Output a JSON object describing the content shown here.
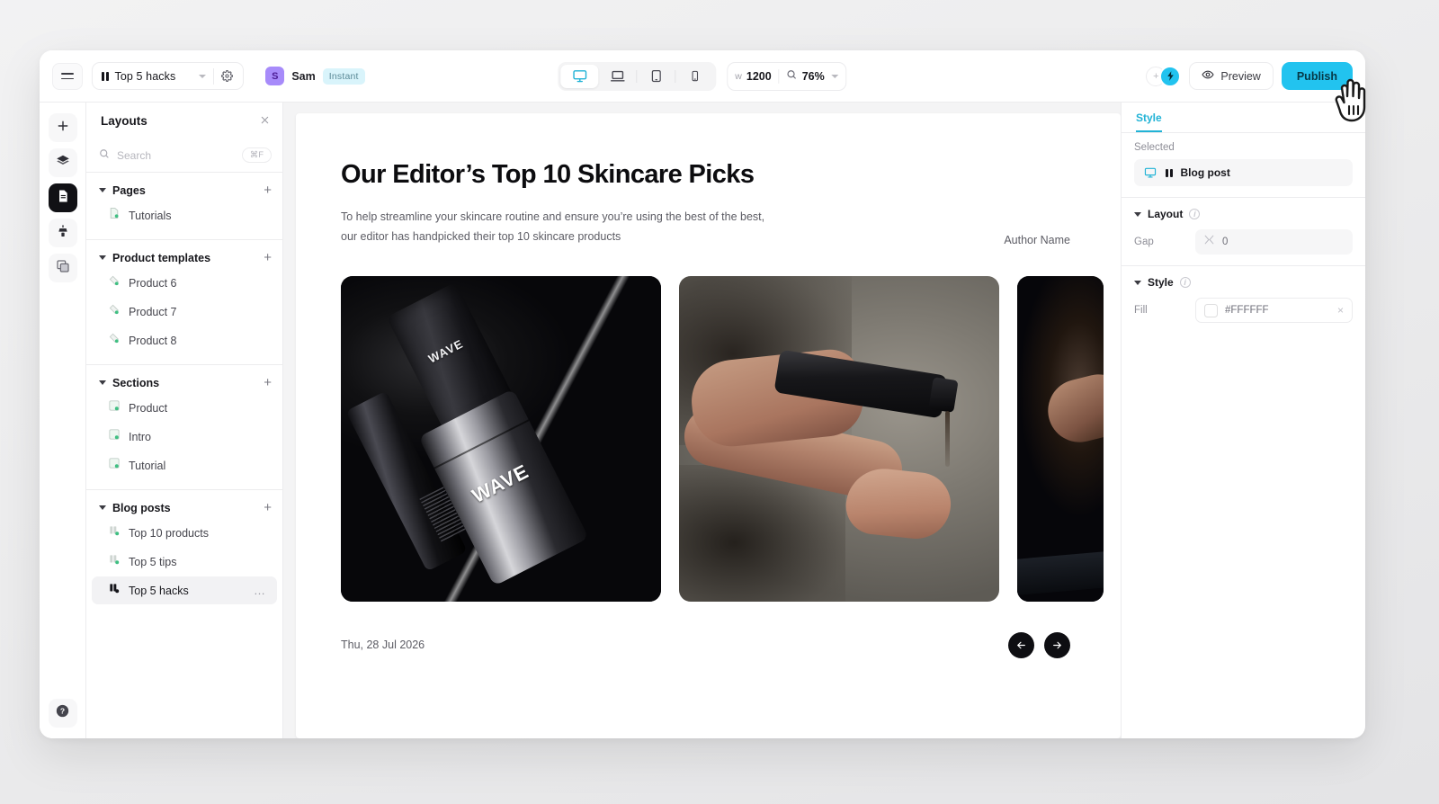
{
  "topbar": {
    "menu_icon": "hamburger-icon",
    "document": {
      "icon": "blog-post-icon",
      "title": "Top 5 hacks",
      "caret": "chevron-down-icon",
      "settings_icon": "gear-icon"
    },
    "user": {
      "avatar_initial": "S",
      "name": "Sam",
      "badge": "Instant",
      "badge_color": "#d9f4fb"
    },
    "devices": [
      {
        "name": "desktop",
        "icon": "monitor-icon",
        "active": true
      },
      {
        "name": "laptop",
        "icon": "laptop-icon",
        "active": false
      },
      {
        "name": "tablet",
        "icon": "tablet-icon",
        "active": false
      },
      {
        "name": "mobile",
        "icon": "phone-icon",
        "active": false
      }
    ],
    "width_label": "w",
    "width_value": "1200",
    "zoom_icon": "magnifier-icon",
    "zoom_value": "76%",
    "zoom_caret": "chevron-down-icon",
    "add_collaborator": "+",
    "brand_icon": "app-logo-icon",
    "preview_label": "Preview",
    "preview_icon": "eye-icon",
    "publish_label": "Publish",
    "publish_color": "#22c3ef"
  },
  "rail": [
    {
      "name": "add",
      "icon": "plus-icon",
      "active": false
    },
    {
      "name": "layers",
      "icon": "layers-icon",
      "active": false
    },
    {
      "name": "pages",
      "icon": "document-icon",
      "active": true
    },
    {
      "name": "theme",
      "icon": "brush-icon",
      "active": false
    },
    {
      "name": "assets",
      "icon": "assets-icon",
      "active": false
    }
  ],
  "rail_help": {
    "name": "help",
    "icon": "question-circle-icon"
  },
  "panel": {
    "title": "Layouts",
    "close_icon": "close-icon",
    "search": {
      "icon": "search-icon",
      "placeholder": "Search",
      "shortcut": "⌘F"
    },
    "groups": [
      {
        "title": "Pages",
        "add_icon": "plus-icon",
        "items": [
          {
            "label": "Tutorials",
            "icon": "page-icon",
            "selected": false
          }
        ]
      },
      {
        "title": "Product templates",
        "add_icon": "plus-icon",
        "items": [
          {
            "label": "Product 6",
            "icon": "template-icon",
            "selected": false
          },
          {
            "label": "Product 7",
            "icon": "template-icon",
            "selected": false
          },
          {
            "label": "Product 8",
            "icon": "template-icon",
            "selected": false
          }
        ]
      },
      {
        "title": "Sections",
        "add_icon": "plus-icon",
        "items": [
          {
            "label": "Product",
            "icon": "section-icon",
            "selected": false
          },
          {
            "label": "Intro",
            "icon": "section-icon",
            "selected": false
          },
          {
            "label": "Tutorial",
            "icon": "section-icon",
            "selected": false
          }
        ]
      },
      {
        "title": "Blog posts",
        "add_icon": "plus-icon",
        "items": [
          {
            "label": "Top 10 products",
            "icon": "blog-post-icon",
            "selected": false
          },
          {
            "label": "Top 5 tips",
            "icon": "blog-post-icon",
            "selected": false
          },
          {
            "label": "Top 5 hacks",
            "icon": "blog-post-icon",
            "selected": true,
            "more": "…"
          }
        ]
      }
    ]
  },
  "canvas": {
    "heading": "Our Editor’s Top 10 Skincare Picks",
    "subtext_line1": "To help streamline your skincare routine and ensure you’re using the best of the best,",
    "subtext_line2": "our editor has handpicked their top 10 skincare products",
    "author": "Author Name",
    "date": "Thu, 28 Jul 2026",
    "prev_icon": "arrow-left-icon",
    "next_icon": "arrow-right-icon",
    "slides": [
      {
        "alt": "Black WAVE skincare bottles on dark surface",
        "label": "WAVE"
      },
      {
        "alt": "Hand dispensing serum from black bottle",
        "label": ""
      },
      {
        "alt": "Close-up of hand in dark light",
        "label": ""
      }
    ]
  },
  "right_panel": {
    "tab": "Style",
    "selected_label": "Selected",
    "selected_item": {
      "device_icon": "monitor-icon",
      "type_icon": "blog-post-icon",
      "name": "Blog post"
    },
    "layout": {
      "title": "Layout",
      "info_icon": "info-icon",
      "rows": [
        {
          "label": "Gap",
          "icon": "gap-icon",
          "value": "0"
        }
      ]
    },
    "style": {
      "title": "Style",
      "info_icon": "info-icon",
      "rows": [
        {
          "label": "Fill",
          "swatch": "#FFFFFF",
          "value": "#FFFFFF",
          "clear_icon": "close-icon"
        }
      ]
    }
  },
  "cursor": {
    "icon": "pointing-hand-cursor"
  }
}
